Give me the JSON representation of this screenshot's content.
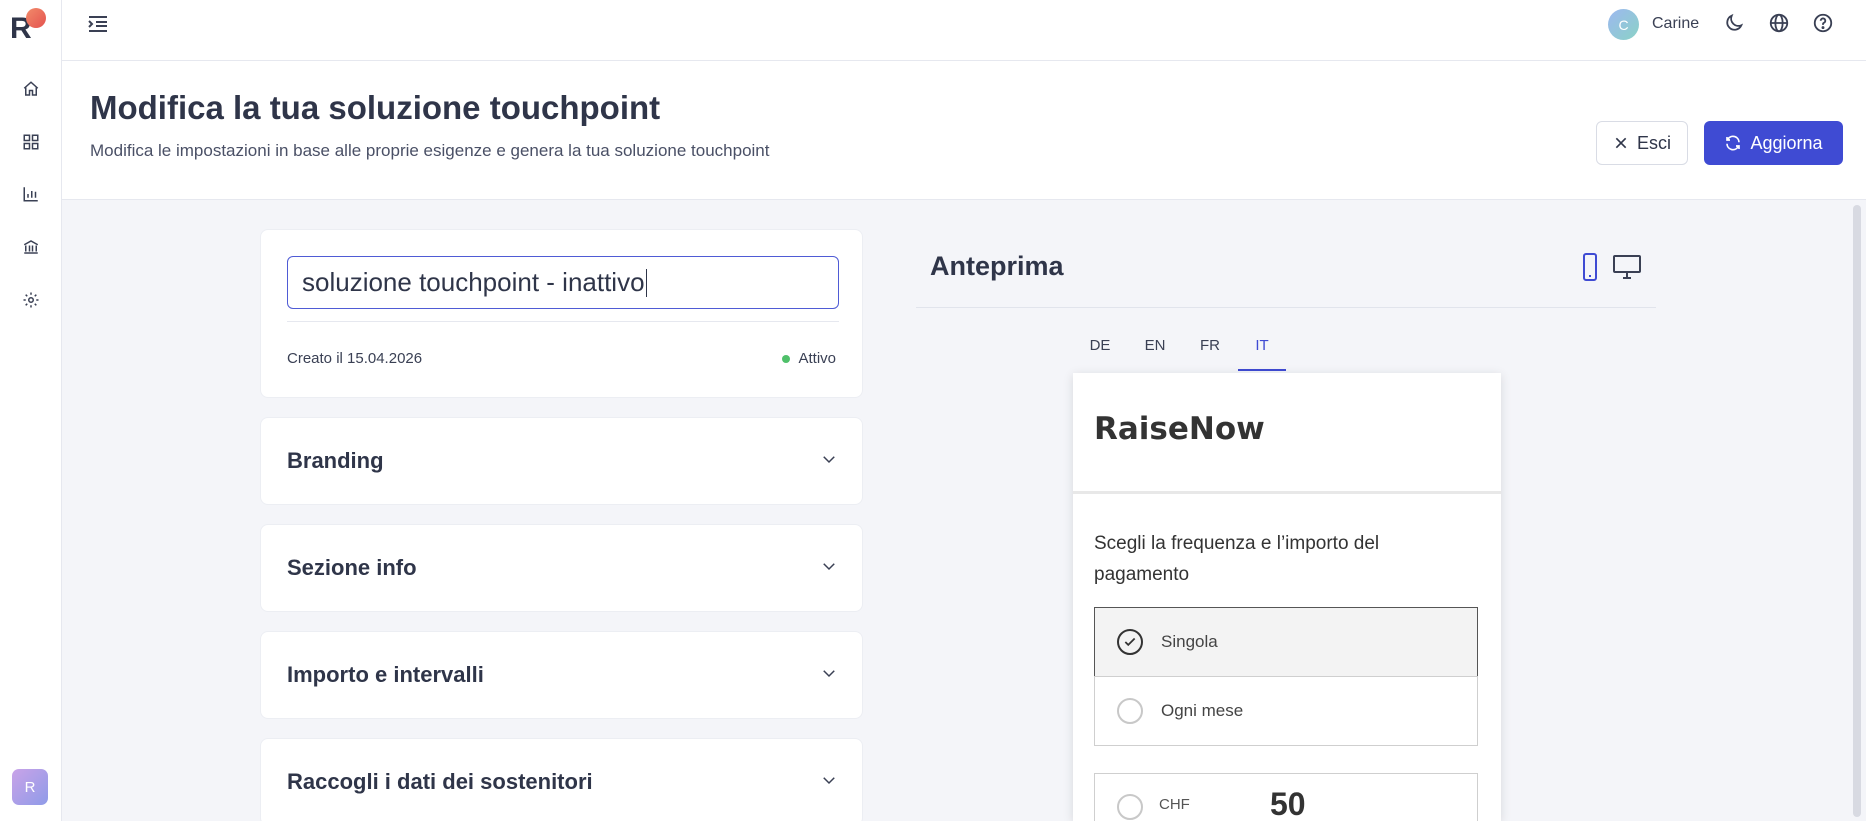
{
  "sidebar": {
    "logo_letter": "R",
    "items": [
      {
        "icon": "home-icon"
      },
      {
        "icon": "dashboard-grid-icon"
      },
      {
        "icon": "bar-chart-icon"
      },
      {
        "icon": "bank-icon"
      },
      {
        "icon": "gear-icon"
      }
    ],
    "avatar_letter": "R"
  },
  "topbar": {
    "user_initial": "C",
    "user_name": "Carine",
    "icons": [
      "moon-icon",
      "globe-icon",
      "help-icon"
    ]
  },
  "header": {
    "title": "Modifica la tua soluzione touchpoint",
    "subtitle": "Modifica le impostazioni in base alle proprie esigenze e genera la tua soluzione touchpoint",
    "exit_label": "Esci",
    "update_label": "Aggiorna"
  },
  "editor": {
    "name_value": "soluzione touchpoint - inattivo",
    "created": "Creato il 15.04.2026",
    "status": "Attivo",
    "sections": [
      "Branding",
      "Sezione info",
      "Importo e intervalli",
      "Raccogli i dati dei sostenitori"
    ]
  },
  "preview": {
    "title": "Anteprima",
    "languages": [
      "DE",
      "EN",
      "FR",
      "IT"
    ],
    "active_language": "IT",
    "widget": {
      "brand": "RaiseNow",
      "question": "Scegli la frequenza e l’importo del pagamento",
      "frequencies": [
        "Singola",
        "Ogni mese"
      ],
      "selected_frequency": "Singola",
      "currency": "CHF",
      "amount": "50"
    }
  },
  "colors": {
    "accent": "#3f4bd3",
    "status_active": "#4fc06a",
    "logo_dot": "#e4524f"
  }
}
